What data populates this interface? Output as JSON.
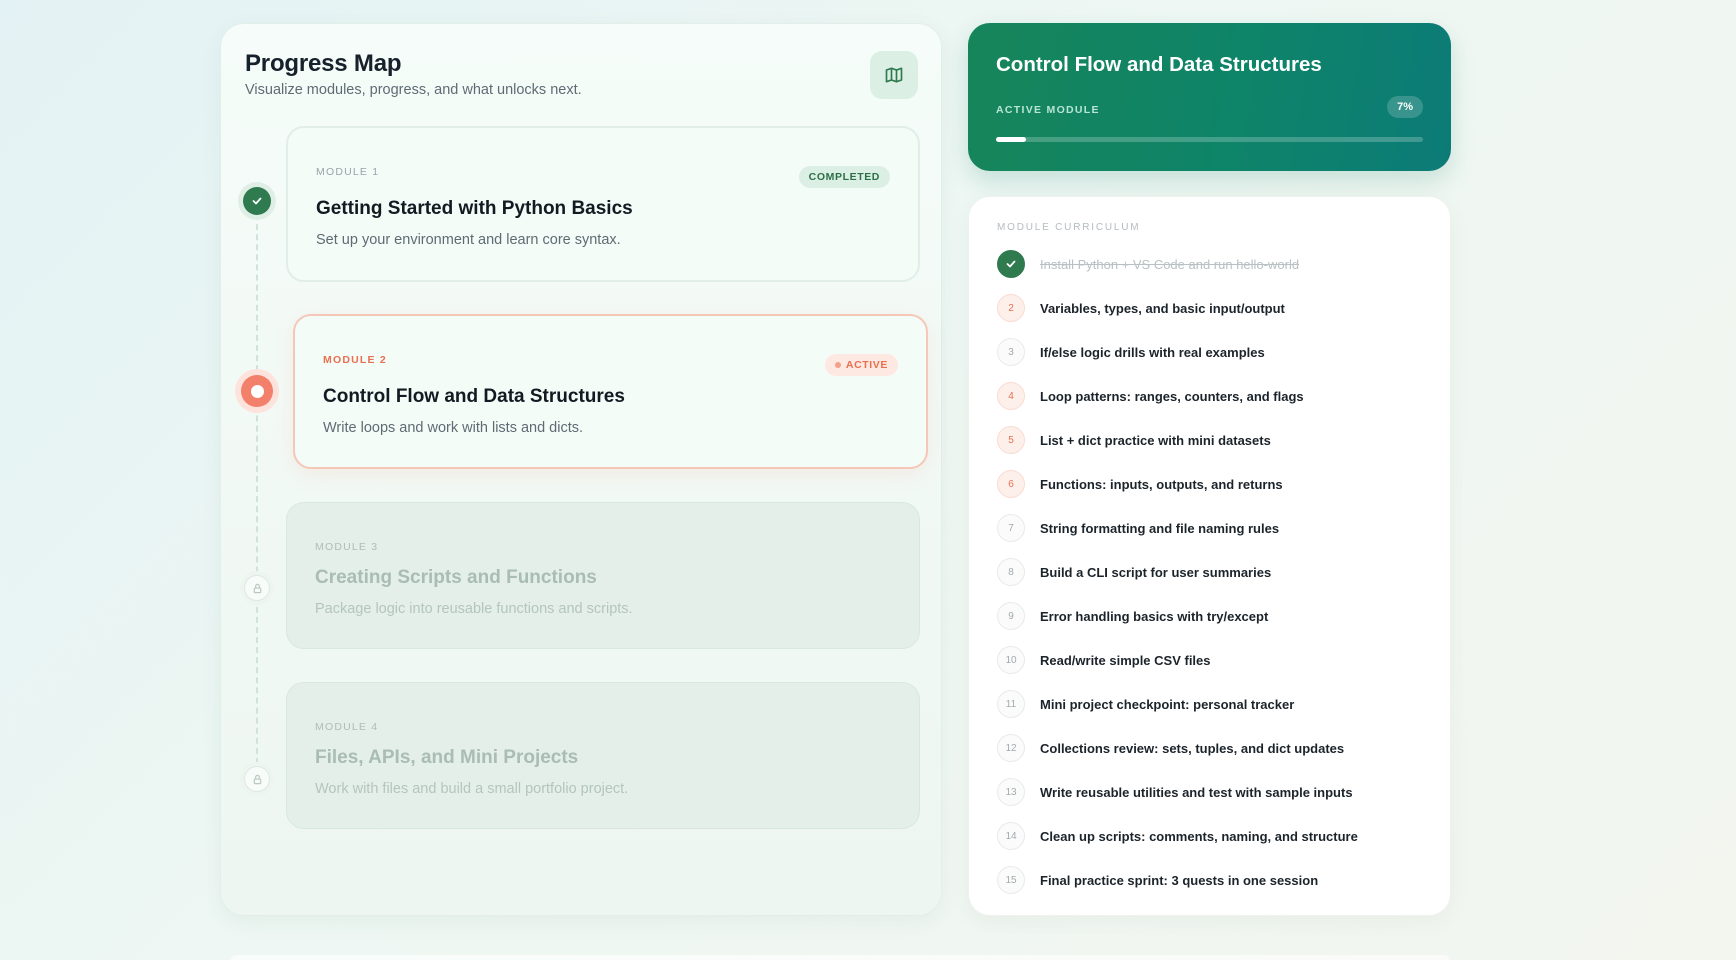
{
  "progress_map": {
    "title": "Progress Map",
    "subtitle": "Visualize modules, progress, and what unlocks next.",
    "map_icon": "map-icon",
    "modules": [
      {
        "label": "MODULE 1",
        "title": "Getting Started with Python Basics",
        "desc": "Set up your environment and learn core syntax.",
        "status": "COMPLETED"
      },
      {
        "label": "MODULE 2",
        "title": "Control Flow and Data Structures",
        "desc": "Write loops and work with lists and dicts.",
        "status": "ACTIVE"
      },
      {
        "label": "MODULE 3",
        "title": "Creating Scripts and Functions",
        "desc": "Package logic into reusable functions and scripts.",
        "status": "locked"
      },
      {
        "label": "MODULE 4",
        "title": "Files, APIs, and Mini Projects",
        "desc": "Work with files and build a small portfolio project.",
        "status": "locked"
      }
    ]
  },
  "active_module": {
    "title": "Control Flow and Data Structures",
    "label": "ACTIVE MODULE",
    "percent_label": "7%",
    "progress": 0.07
  },
  "curriculum": {
    "label": "MODULE CURRICULUM",
    "items": [
      {
        "num": "1",
        "text": "Install Python + VS Code and run hello-world",
        "state": "done"
      },
      {
        "num": "2",
        "text": "Variables, types, and basic input/output",
        "state": "warm"
      },
      {
        "num": "3",
        "text": "If/else logic drills with real examples",
        "state": "pending"
      },
      {
        "num": "4",
        "text": "Loop patterns: ranges, counters, and flags",
        "state": "warm"
      },
      {
        "num": "5",
        "text": "List + dict practice with mini datasets",
        "state": "warm"
      },
      {
        "num": "6",
        "text": "Functions: inputs, outputs, and returns",
        "state": "warm"
      },
      {
        "num": "7",
        "text": "String formatting and file naming rules",
        "state": "pending"
      },
      {
        "num": "8",
        "text": "Build a CLI script for user summaries",
        "state": "pending"
      },
      {
        "num": "9",
        "text": "Error handling basics with try/except",
        "state": "pending"
      },
      {
        "num": "10",
        "text": "Read/write simple CSV files",
        "state": "pending"
      },
      {
        "num": "11",
        "text": "Mini project checkpoint: personal tracker",
        "state": "pending"
      },
      {
        "num": "12",
        "text": "Collections review: sets, tuples, and dict updates",
        "state": "pending"
      },
      {
        "num": "13",
        "text": "Write reusable utilities and test with sample inputs",
        "state": "pending"
      },
      {
        "num": "14",
        "text": "Clean up scripts: comments, naming, and structure",
        "state": "pending"
      },
      {
        "num": "15",
        "text": "Final practice sprint: 3 quests in one session",
        "state": "pending"
      }
    ]
  },
  "colors": {
    "accent_green": "#2f7a4f",
    "accent_coral": "#f3806a",
    "teal": "#0e8468"
  }
}
